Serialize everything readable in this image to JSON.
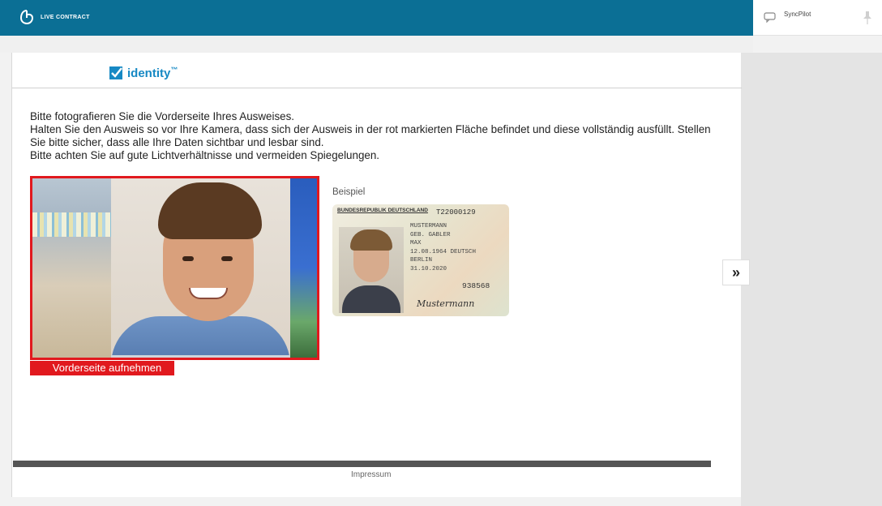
{
  "header": {
    "brand": "LIVE CONTRACT"
  },
  "sidebar": {
    "syncpilot_label": "SyncPilot"
  },
  "identity": {
    "logo_text": "identity",
    "trademark": "™"
  },
  "instructions": {
    "line1": "Bitte fotografieren Sie die Vorderseite Ihres Ausweises.",
    "line2": "Halten Sie den Ausweis so vor Ihre Kamera, dass sich der Ausweis in der rot markierten Fläche befindet und diese vollständig ausfüllt. Stellen Sie bitte sicher, dass alle Ihre Daten sichtbar und lesbar sind.",
    "line3": "Bitte achten Sie auf gute Lichtverhältnisse und vermeiden Spiegelungen."
  },
  "capture": {
    "button_label": "Vorderseite aufnehmen"
  },
  "example": {
    "label": "Beispiel",
    "card_header": "BUNDESREPUBLIK DEUTSCHLAND",
    "card_number": "T22000129",
    "surname": "MUSTERMANN",
    "birth_name": "GEB. GABLER",
    "given_name": "MAX",
    "birth_date_nationality": "12.08.1964 DEUTSCH",
    "birth_place": "BERLIN",
    "expiry": "31.10.2020",
    "access_number": "938568",
    "signature": "Mustermann"
  },
  "navigation": {
    "next_label": "»"
  },
  "footer": {
    "impressum": "Impressum"
  },
  "colors": {
    "header": "#0b6f95",
    "accent_red": "#e1191e",
    "identity_blue": "#1789c4"
  }
}
